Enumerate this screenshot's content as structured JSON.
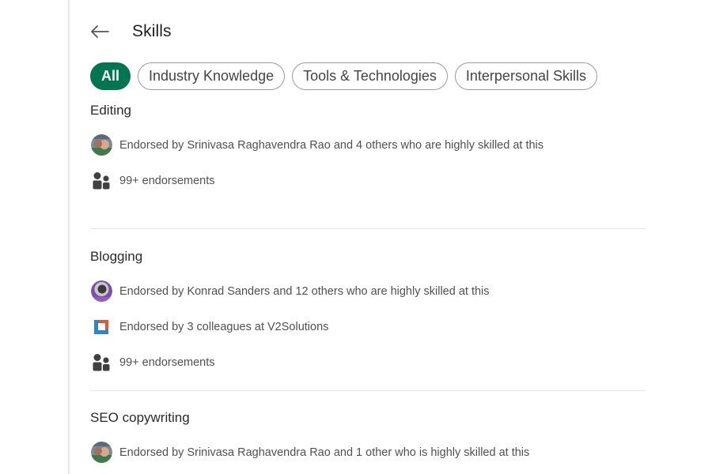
{
  "header": {
    "title": "Skills",
    "back_icon": "arrow-left-icon"
  },
  "filters": [
    {
      "label": "All",
      "active": true
    },
    {
      "label": "Industry Knowledge",
      "active": false
    },
    {
      "label": "Tools & Technologies",
      "active": false
    },
    {
      "label": "Interpersonal Skills",
      "active": false
    }
  ],
  "skills": [
    {
      "name": "Editing",
      "rows": [
        {
          "icon": "avatar-photo",
          "text": "Endorsed by Srinivasa Raghavendra Rao and 4 others who are highly skilled at this"
        },
        {
          "icon": "people-icon",
          "text": "99+ endorsements"
        }
      ]
    },
    {
      "name": "Blogging",
      "rows": [
        {
          "icon": "avatar-photo",
          "text": "Endorsed by Konrad Sanders and 12 others who are highly skilled at this"
        },
        {
          "icon": "company-logo",
          "text": "Endorsed by 3 colleagues at V2Solutions"
        },
        {
          "icon": "people-icon",
          "text": "99+ endorsements"
        }
      ]
    },
    {
      "name": "SEO copywriting",
      "rows": [
        {
          "icon": "avatar-photo",
          "text": "Endorsed by Srinivasa Raghavendra Rao and 1 other who is highly skilled at this"
        }
      ]
    }
  ],
  "colors": {
    "accent": "#01754f",
    "divider": "#e6e6e6",
    "text_secondary": "#505050"
  }
}
